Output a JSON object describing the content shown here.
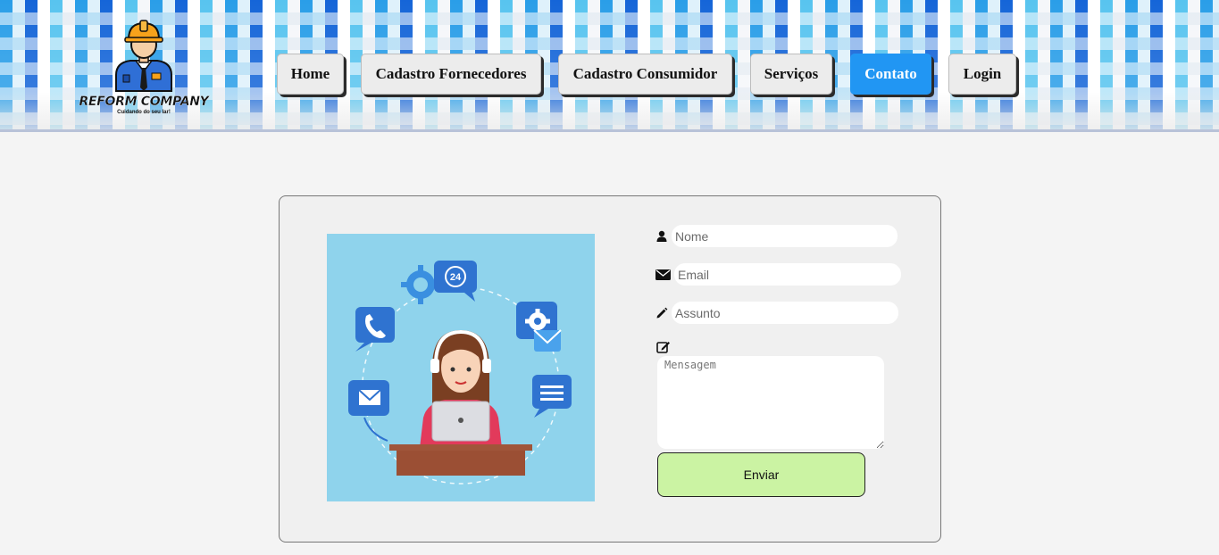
{
  "logo": {
    "title": "REFORM COMPANY",
    "subtitle": "Cuidando do seu lar!"
  },
  "nav": [
    {
      "label": "Home"
    },
    {
      "label": "Cadastro Fornecedores"
    },
    {
      "label": "Cadastro Consumidor"
    },
    {
      "label": "Serviços"
    },
    {
      "label": "Contato",
      "active": true
    },
    {
      "label": "Login"
    }
  ],
  "illustration": {
    "badge_text": "24"
  },
  "form": {
    "name_placeholder": "Nome",
    "email_placeholder": "Email",
    "subject_placeholder": "Assunto",
    "message_placeholder": "Mensagem",
    "submit_label": "Enviar"
  },
  "colors": {
    "active_nav": "#2196f3",
    "submit_bg": "#cbf3a3",
    "illustration_bg": "#8fd3ec"
  }
}
